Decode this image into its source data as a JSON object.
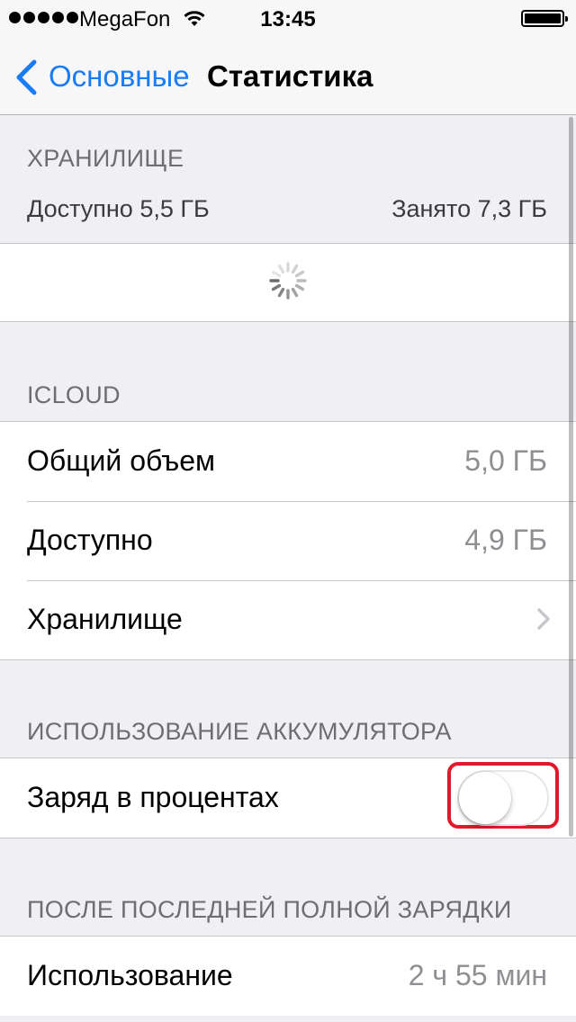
{
  "status_bar": {
    "carrier": "MegaFon",
    "time": "13:45"
  },
  "nav": {
    "back_label": "Основные",
    "title": "Статистика"
  },
  "storage": {
    "header": "ХРАНИЛИЩЕ",
    "available": "Доступно 5,5 ГБ",
    "used": "Занято 7,3 ГБ"
  },
  "icloud": {
    "header": "ICLOUD",
    "rows": [
      {
        "label": "Общий объем",
        "value": "5,0 ГБ"
      },
      {
        "label": "Доступно",
        "value": "4,9 ГБ"
      },
      {
        "label": "Хранилище"
      }
    ]
  },
  "battery_usage": {
    "header": "ИСПОЛЬЗОВАНИЕ АККУМУЛЯТОРА",
    "toggle_label": "Заряд в процентах",
    "toggle_on": false
  },
  "since_charge": {
    "header": "ПОСЛЕ ПОСЛЕДНЕЙ ПОЛНОЙ ЗАРЯДКИ",
    "rows": [
      {
        "label": "Использование",
        "value": "2 ч 55 мин"
      }
    ]
  },
  "colors": {
    "accent": "#1a7cf5",
    "highlight": "#e1192b",
    "background": "#efeff4"
  },
  "icons": [
    "signal-dots",
    "wifi-icon",
    "battery-icon",
    "back-chevron-icon",
    "chevron-right-icon",
    "spinner-icon"
  ]
}
